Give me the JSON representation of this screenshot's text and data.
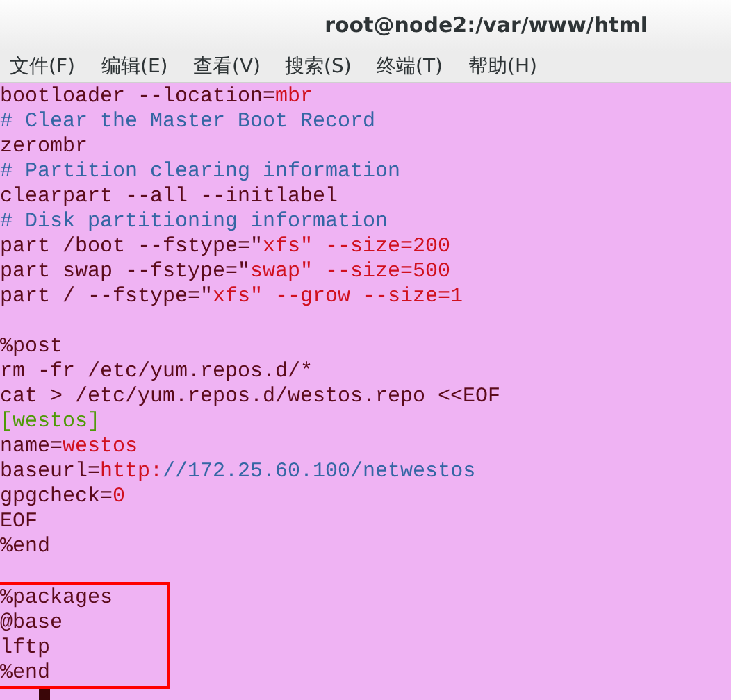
{
  "window": {
    "title": "root@node2:/var/www/html"
  },
  "menu": [
    "文件(F)",
    "编辑(E)",
    "查看(V)",
    "搜索(S)",
    "终端(T)",
    "帮助(H)"
  ],
  "blocks": [
    {
      "highlighted": false,
      "lines": [
        {
          "kind": "code",
          "segments": [
            {
              "kind": "plain",
              "text": "bootloader --location="
            },
            {
              "kind": "value",
              "text": "mbr"
            }
          ]
        },
        {
          "kind": "code",
          "segments": [
            {
              "kind": "comment",
              "text": "# Clear the Master Boot Record"
            }
          ]
        },
        {
          "kind": "code",
          "segments": [
            {
              "kind": "plain",
              "text": "zerombr"
            }
          ]
        },
        {
          "kind": "code",
          "segments": [
            {
              "kind": "comment",
              "text": "# Partition clearing information"
            }
          ]
        },
        {
          "kind": "code",
          "segments": [
            {
              "kind": "plain",
              "text": "clearpart --all --initlabel"
            }
          ]
        },
        {
          "kind": "code",
          "segments": [
            {
              "kind": "comment",
              "text": "# Disk partitioning information"
            }
          ]
        },
        {
          "kind": "code",
          "segments": [
            {
              "kind": "plain",
              "text": "part /boot --fstype=\""
            },
            {
              "kind": "value",
              "text": "xfs\" --size=200"
            }
          ]
        },
        {
          "kind": "code",
          "segments": [
            {
              "kind": "plain",
              "text": "part swap --fstype=\""
            },
            {
              "kind": "value",
              "text": "swap\" --size=500"
            }
          ]
        },
        {
          "kind": "code",
          "segments": [
            {
              "kind": "plain",
              "text": "part / --fstype=\""
            },
            {
              "kind": "value",
              "text": "xfs\" --grow --size=1"
            }
          ]
        },
        {
          "kind": "blank"
        },
        {
          "kind": "code",
          "segments": [
            {
              "kind": "plain",
              "text": "%post"
            }
          ]
        },
        {
          "kind": "code",
          "segments": [
            {
              "kind": "plain",
              "text": "rm -fr /etc/yum.repos.d/*"
            }
          ]
        },
        {
          "kind": "code",
          "segments": [
            {
              "kind": "plain",
              "text": "cat > /etc/yum.repos.d/westos.repo <<EOF"
            }
          ]
        },
        {
          "kind": "code",
          "segments": [
            {
              "kind": "section",
              "text": "[westos]"
            }
          ]
        },
        {
          "kind": "code",
          "segments": [
            {
              "kind": "plain",
              "text": "name="
            },
            {
              "kind": "value",
              "text": "westos"
            }
          ]
        },
        {
          "kind": "code",
          "segments": [
            {
              "kind": "plain",
              "text": "baseurl="
            },
            {
              "kind": "value",
              "text": "http:"
            },
            {
              "kind": "comment",
              "text": "//172.25.60.100/netwestos"
            }
          ]
        },
        {
          "kind": "code",
          "segments": [
            {
              "kind": "plain",
              "text": "gpgcheck="
            },
            {
              "kind": "value",
              "text": "0"
            }
          ]
        },
        {
          "kind": "code",
          "segments": [
            {
              "kind": "plain",
              "text": "EOF"
            }
          ]
        },
        {
          "kind": "code",
          "segments": [
            {
              "kind": "plain",
              "text": "%end"
            }
          ]
        },
        {
          "kind": "blank"
        }
      ]
    },
    {
      "highlighted": true,
      "lines": [
        {
          "kind": "code",
          "segments": [
            {
              "kind": "plain",
              "text": "%packages"
            }
          ]
        },
        {
          "kind": "code",
          "segments": [
            {
              "kind": "plain",
              "text": "@base"
            }
          ]
        },
        {
          "kind": "code",
          "segments": [
            {
              "kind": "plain",
              "text": "lftp"
            }
          ]
        },
        {
          "kind": "code",
          "segments": [
            {
              "kind": "plain",
              "text": "%end"
            }
          ]
        }
      ]
    }
  ]
}
